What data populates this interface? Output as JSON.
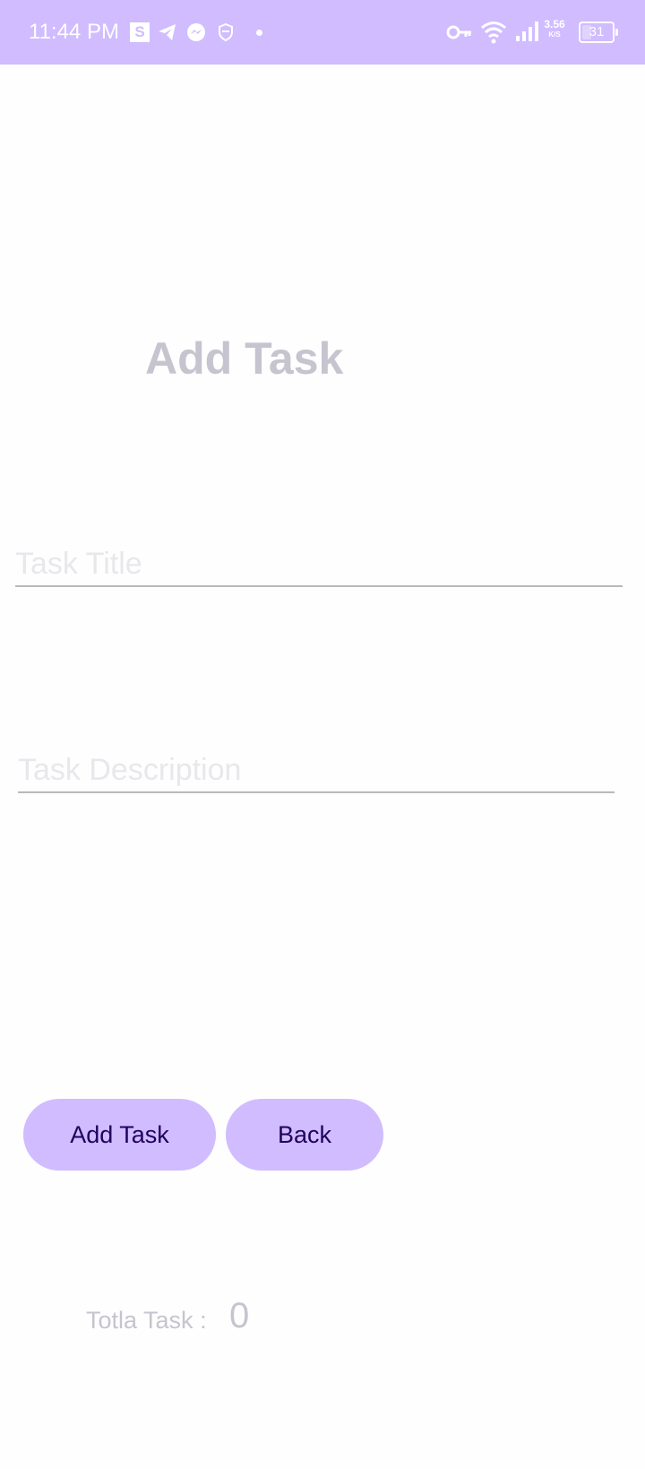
{
  "status_bar": {
    "time": "11:44 PM",
    "app_s_badge": "S",
    "net_speed_value": "3.56",
    "net_speed_unit": "K/S",
    "battery_level": "31",
    "icons": [
      "s-app-icon",
      "telegram-icon",
      "messenger-icon",
      "shield-icon",
      "notification-dot-icon",
      "vpn-key-icon",
      "wifi-icon",
      "cell-signal-icon",
      "battery-icon"
    ],
    "background_color": "#d0bcff"
  },
  "page": {
    "heading": "Add Task"
  },
  "form": {
    "title_placeholder": "Task Title",
    "title_value": "",
    "description_placeholder": "Task Description",
    "description_value": ""
  },
  "actions": {
    "add_label": "Add Task",
    "back_label": "Back",
    "button_color": "#d0bcff",
    "button_text_color": "#21005d"
  },
  "summary": {
    "total_label": "Totla Task :",
    "total_value": "0"
  }
}
